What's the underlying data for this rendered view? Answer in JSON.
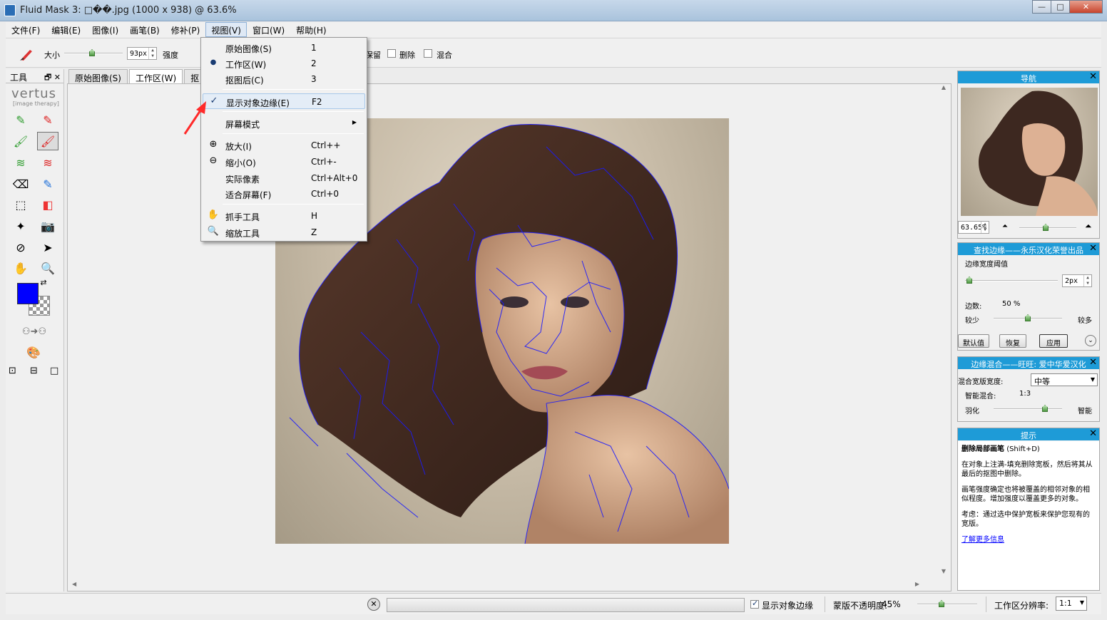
{
  "window": {
    "title": "Fluid Mask 3: □��.jpg (1000 x 938) @ 63.6%"
  },
  "menubar": [
    "文件(F)",
    "编辑(E)",
    "图像(I)",
    "画笔(B)",
    "修补(P)",
    "视图(V)",
    "窗口(W)",
    "帮助(H)"
  ],
  "toolbar": {
    "size_label": "大小",
    "size_value": "93px",
    "strength_label": "强度",
    "keep_label": "保留",
    "delete_label": "删除",
    "blend_label": "混合"
  },
  "tools_panel": {
    "title": "工具",
    "logo": "vertus",
    "logo_sub": "[image therapy]"
  },
  "doc_tabs": [
    "原始图像(S)",
    "工作区(W)",
    "抠"
  ],
  "view_menu": {
    "items": [
      {
        "label": "原始图像(S)",
        "shortcut": "1"
      },
      {
        "label": "工作区(W)",
        "shortcut": "2"
      },
      {
        "label": "抠图后(C)",
        "shortcut": "3"
      },
      {
        "label": "显示对象边缘(E)",
        "shortcut": "F2"
      },
      {
        "label": "屏幕模式",
        "shortcut": ""
      },
      {
        "label": "放大(I)",
        "shortcut": "Ctrl++"
      },
      {
        "label": "缩小(O)",
        "shortcut": "Ctrl+-"
      },
      {
        "label": "实际像素",
        "shortcut": "Ctrl+Alt+0"
      },
      {
        "label": "适合屏幕(F)",
        "shortcut": "Ctrl+0"
      },
      {
        "label": "抓手工具",
        "shortcut": "H"
      },
      {
        "label": "缩放工具",
        "shortcut": "Z"
      }
    ]
  },
  "navigator": {
    "title": "导航",
    "zoom": "63.65%"
  },
  "find_edges": {
    "title": "查找边缘——永乐汉化荣誉出品",
    "threshold_label": "边缘宽度阈值",
    "threshold_value": "2px",
    "edges_label": "边数:",
    "edges_value": "50 %",
    "less_label": "较少",
    "more_label": "较多",
    "default_btn": "默认值",
    "restore_btn": "恢复",
    "apply_btn": "应用"
  },
  "edge_blend": {
    "title": "边缘混合——旺旺: 爱中华爱汉化",
    "width_label": "混合宽版宽度:",
    "width_value": "中等",
    "smart_label": "智能混合:",
    "smart_value": "1:3",
    "feather_label": "羽化",
    "smart_right": "智能"
  },
  "hints": {
    "title": "提示",
    "heading": "删除局部画笔",
    "heading_shortcut": "(Shift+D)",
    "p1": "在对象上注满-填充删除宽板，然后将其从最后的抠图中删除。",
    "p2": "画笔强度确定也将被覆盖的相邻对象的相似程度。增加强度以覆盖更多的对象。",
    "p3": "考虑：通过选中保护宽板来保护您现有的宽版。",
    "link": "了解更多信息"
  },
  "statusbar": {
    "show_edges_label": "显示对象边缘",
    "mask_opacity_label": "蒙版不透明度:",
    "mask_opacity_value": "45%",
    "resolution_label": "工作区分辨率:",
    "resolution_value": "1:1"
  },
  "colors": {
    "accent": "#1e9bd7",
    "foreground_swatch": "#0000ff",
    "edge_lines": "#1a1aff",
    "annotation_arrow": "#ff2a2a"
  }
}
